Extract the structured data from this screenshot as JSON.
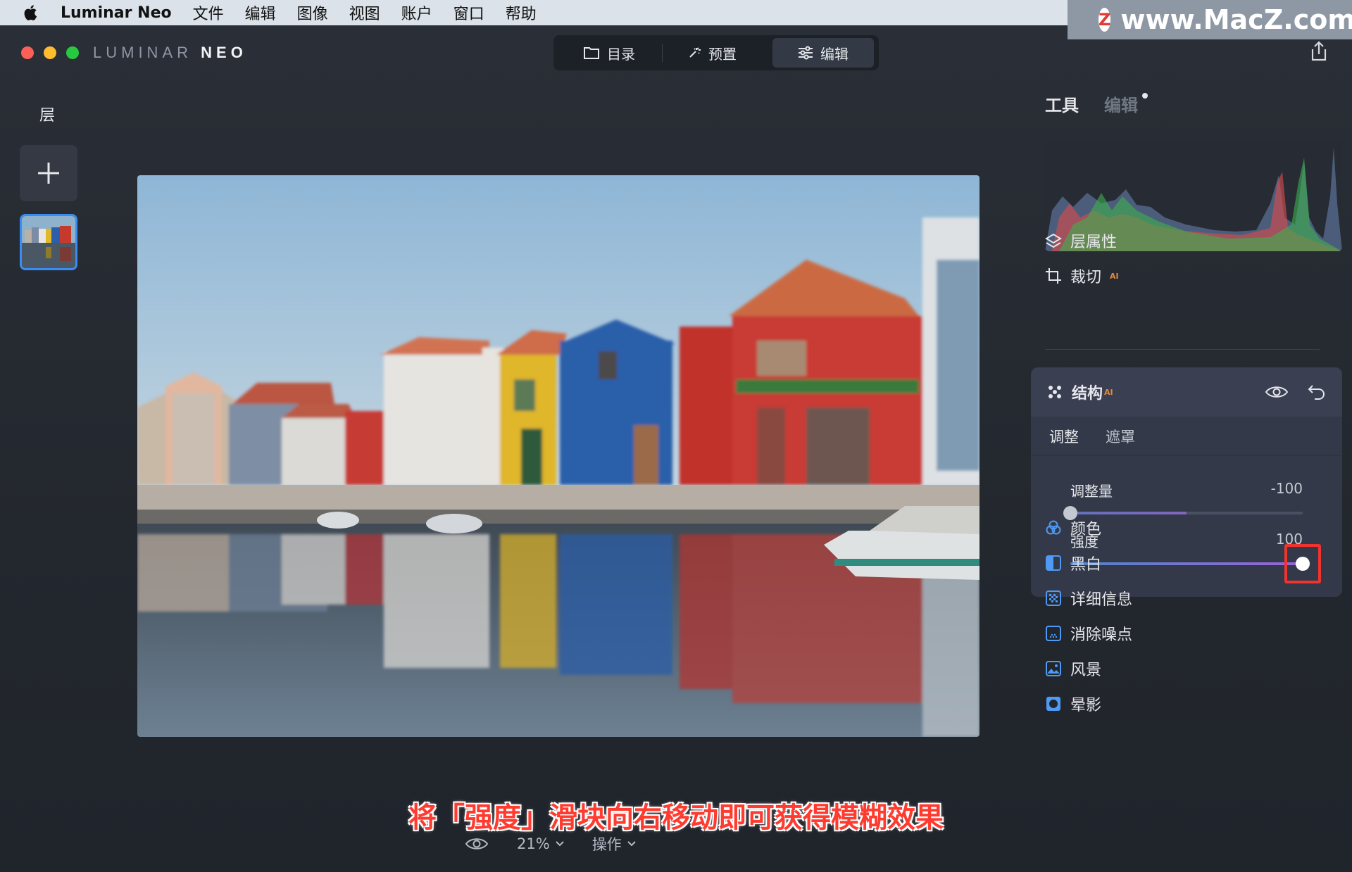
{
  "menubar": {
    "app_name": "Luminar Neo",
    "items": [
      "文件",
      "编辑",
      "图像",
      "视图",
      "账户",
      "窗口",
      "帮助"
    ]
  },
  "watermark": {
    "badge": "Z",
    "text": "www.MacZ.com"
  },
  "window": {
    "logo_main": "LUMINAR",
    "logo_neo": "NEO",
    "nav": [
      {
        "label": "目录",
        "icon": "folder-icon"
      },
      {
        "label": "预置",
        "icon": "magic-wand-icon"
      },
      {
        "label": "编辑",
        "icon": "sliders-icon",
        "active": true
      }
    ]
  },
  "layers": {
    "title": "层"
  },
  "right_panel": {
    "tabs": {
      "tools": "工具",
      "edits": "编辑"
    },
    "layer_props": "层属性",
    "crop": "裁切",
    "crop_badge": "AI",
    "structure": {
      "title": "结构",
      "badge": "AI",
      "tab_adjust": "调整",
      "tab_mask": "遮罩",
      "amount_label": "调整量",
      "amount_value": "-100",
      "amount_fraction": 0.0,
      "strength_label": "强度",
      "strength_value": "100",
      "strength_fraction": 1.0
    },
    "tools": [
      {
        "label": "颜色",
        "icon": "color-circles-icon"
      },
      {
        "label": "黑白",
        "icon": "black-white-icon"
      },
      {
        "label": "详细信息",
        "icon": "details-icon"
      },
      {
        "label": "消除噪点",
        "icon": "denoise-icon"
      },
      {
        "label": "风景",
        "icon": "landscape-icon"
      },
      {
        "label": "晕影",
        "icon": "vignette-icon"
      }
    ]
  },
  "bottom": {
    "zoom": "21%",
    "actions": "操作"
  },
  "caption": "将「强度」滑块向右移动即可获得模糊效果",
  "colors": {
    "accent": "#3b8cf2",
    "highlight": "#f0332e",
    "caption": "#ff3b30"
  }
}
